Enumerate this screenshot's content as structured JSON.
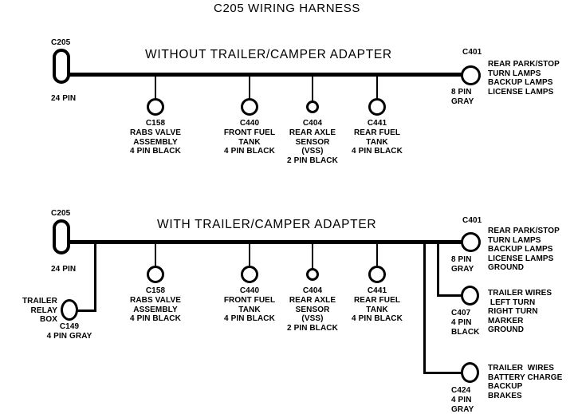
{
  "document": {
    "title": "C205 WIRING HARNESS"
  },
  "diagrams": [
    {
      "heading": "WITHOUT  TRAILER/CAMPER  ADAPTER",
      "source_connector": {
        "name": "C205",
        "pins": "24 PIN"
      },
      "branches": [
        {
          "name": "C158",
          "description": "RABS VALVE\nASSEMBLY\n4 PIN BLACK"
        },
        {
          "name": "C440",
          "description": "FRONT FUEL\nTANK\n4 PIN BLACK"
        },
        {
          "name": "C404",
          "description": "REAR AXLE\nSENSOR\n(VSS)\n2 PIN BLACK"
        },
        {
          "name": "C441",
          "description": "REAR FUEL\nTANK\n4 PIN BLACK"
        }
      ],
      "end_connectors": [
        {
          "name": "C401",
          "pins": "8 PIN\nGRAY",
          "circuits": "REAR PARK/STOP\nTURN LAMPS\nBACKUP LAMPS\nLICENSE LAMPS"
        }
      ]
    },
    {
      "heading": "WITH TRAILER/CAMPER  ADAPTER",
      "source_connector": {
        "name": "C205",
        "pins": "24 PIN"
      },
      "aux_connector": {
        "name": "C149",
        "pins": "4 PIN GRAY",
        "description": "TRAILER\nRELAY\nBOX"
      },
      "branches": [
        {
          "name": "C158",
          "description": "RABS VALVE\nASSEMBLY\n4 PIN BLACK"
        },
        {
          "name": "C440",
          "description": "FRONT FUEL\nTANK\n4 PIN BLACK"
        },
        {
          "name": "C404",
          "description": "REAR AXLE\nSENSOR\n(VSS)\n2 PIN BLACK"
        },
        {
          "name": "C441",
          "description": "REAR FUEL\nTANK\n4 PIN BLACK"
        }
      ],
      "end_connectors": [
        {
          "name": "C401",
          "pins": "8 PIN\nGRAY",
          "circuits": "REAR PARK/STOP\nTURN LAMPS\nBACKUP LAMPS\nLICENSE LAMPS\nGROUND"
        },
        {
          "name": "C407",
          "pins": "4 PIN\nBLACK",
          "circuits": "TRAILER WIRES\n LEFT TURN\nRIGHT TURN\nMARKER\nGROUND"
        },
        {
          "name": "C424",
          "pins": "4 PIN\nGRAY",
          "circuits": "TRAILER  WIRES\nBATTERY CHARGE\nBACKUP\nBRAKES"
        }
      ]
    }
  ],
  "colors": {
    "ink": "#000000",
    "background": "#ffffff"
  }
}
